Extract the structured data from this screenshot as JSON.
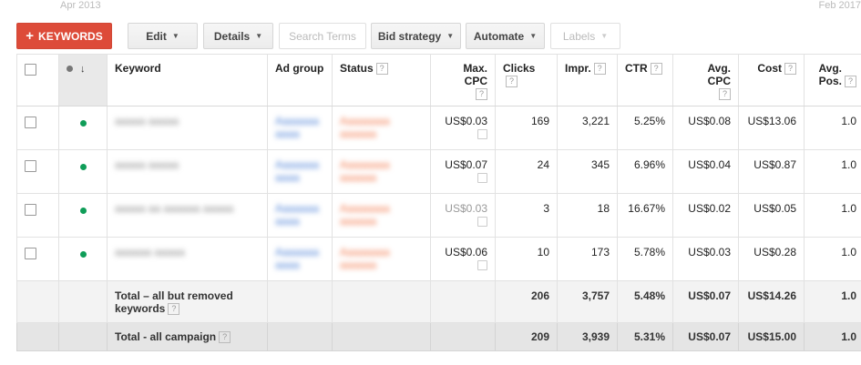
{
  "dates": {
    "left": "Apr 2013",
    "right": "Feb 2017"
  },
  "toolbar": {
    "add_keywords": "KEYWORDS",
    "edit": "Edit",
    "details": "Details",
    "search_terms": "Search Terms",
    "bid_strategy": "Bid strategy",
    "automate": "Automate",
    "labels": "Labels"
  },
  "columns": {
    "keyword": "Keyword",
    "ad_group": "Ad group",
    "status": "Status",
    "max_cpc": "Max. CPC",
    "clicks": "Clicks",
    "impr": "Impr.",
    "ctr": "CTR",
    "avg_cpc": "Avg. CPC",
    "cost": "Cost",
    "avg_pos": "Avg. Pos."
  },
  "rows": [
    {
      "keyword": "aaaaa aaaaa",
      "ad_group": "Aaaaaaa aaaa",
      "status": "Aaaaaaaa aaaaaa",
      "max_cpc": "US$0.03",
      "clicks": "169",
      "impr": "3,221",
      "ctr": "5.25%",
      "avg_cpc": "US$0.08",
      "cost": "US$13.06",
      "avg_pos": "1.0"
    },
    {
      "keyword": "aaaaa aaaaa",
      "ad_group": "Aaaaaaa aaaa",
      "status": "Aaaaaaaa aaaaaa",
      "max_cpc": "US$0.07",
      "clicks": "24",
      "impr": "345",
      "ctr": "6.96%",
      "avg_cpc": "US$0.04",
      "cost": "US$0.87",
      "avg_pos": "1.0"
    },
    {
      "keyword": "aaaaa aa aaaaaa aaaaa",
      "ad_group": "Aaaaaaa aaaa",
      "status": "Aaaaaaaa aaaaaa",
      "max_cpc": "US$0.03",
      "clicks": "3",
      "impr": "18",
      "ctr": "16.67%",
      "avg_cpc": "US$0.02",
      "cost": "US$0.05",
      "avg_pos": "1.0"
    },
    {
      "keyword": "aaaaaa aaaaa",
      "ad_group": "Aaaaaaa aaaa",
      "status": "Aaaaaaaa aaaaaa",
      "max_cpc": "US$0.06",
      "clicks": "10",
      "impr": "173",
      "ctr": "5.78%",
      "avg_cpc": "US$0.03",
      "cost": "US$0.28",
      "avg_pos": "1.0"
    }
  ],
  "totals": {
    "all_but_removed": {
      "label": "Total – all but removed keywords",
      "clicks": "206",
      "impr": "3,757",
      "ctr": "5.48%",
      "avg_cpc": "US$0.07",
      "cost": "US$14.26",
      "avg_pos": "1.0"
    },
    "all_campaign": {
      "label": "Total - all campaign",
      "clicks": "209",
      "impr": "3,939",
      "ctr": "5.31%",
      "avg_cpc": "US$0.07",
      "cost": "US$15.00",
      "avg_pos": "1.0"
    }
  },
  "colors": {
    "primary": "#dd4b39",
    "status_dot": "#0f9d58"
  }
}
